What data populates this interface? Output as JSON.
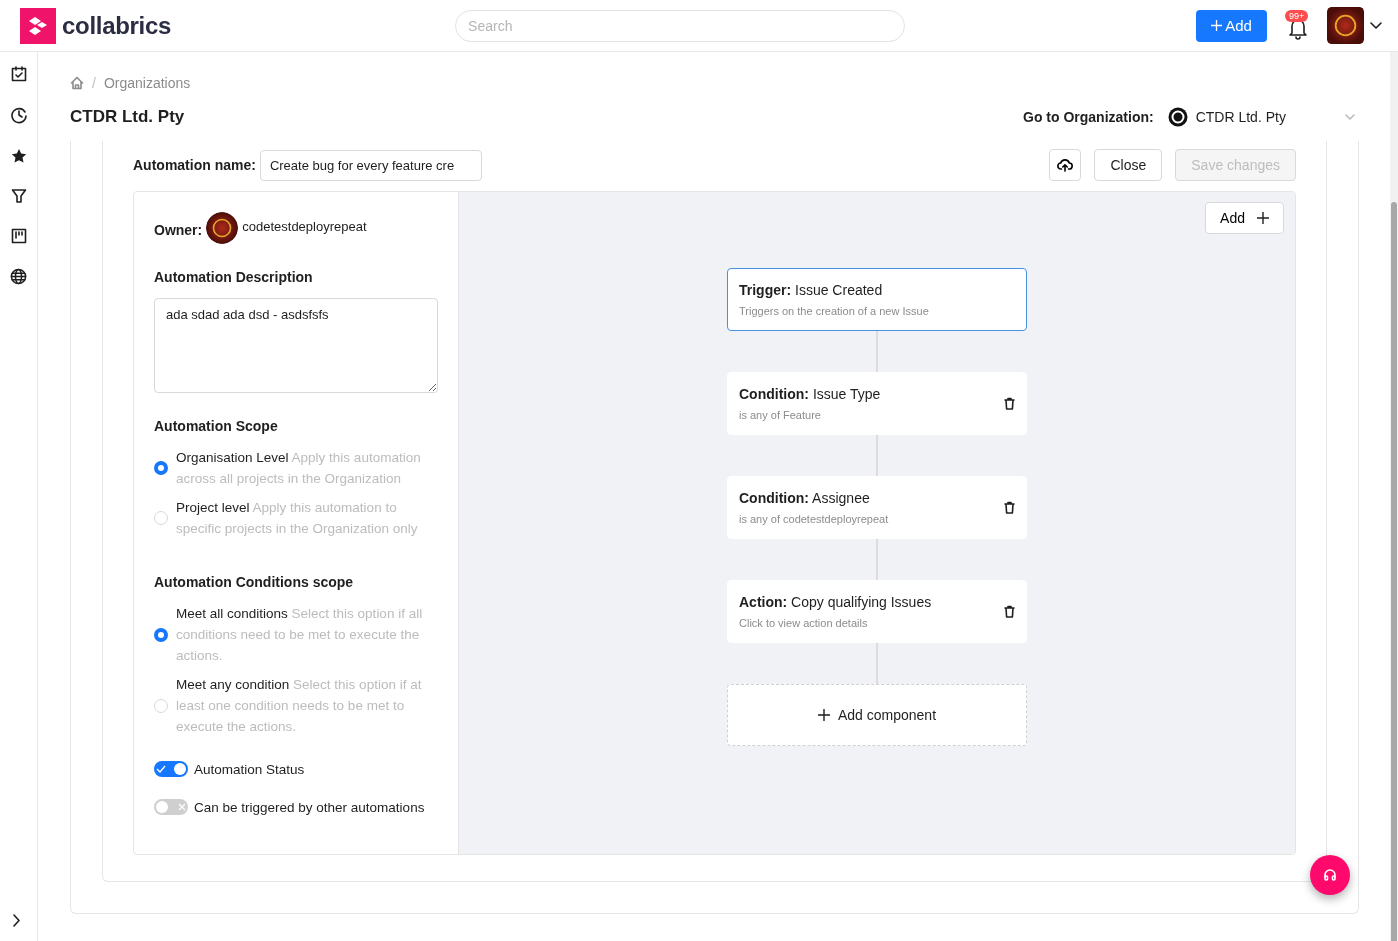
{
  "header": {
    "logo_text": "collabrics",
    "search": {
      "placeholder": "Search"
    },
    "add_button": "Add",
    "notification_badge": "99+"
  },
  "breadcrumb": {
    "separator": "/",
    "items": [
      "Organizations"
    ]
  },
  "page_title": "CTDR Ltd. Pty",
  "org_switch": {
    "label": "Go to Organization:",
    "value": "CTDR Ltd. Pty"
  },
  "automation": {
    "name_label": "Automation name:",
    "name_value": "Create bug for every feature cre",
    "buttons": [
      {
        "label": "Close",
        "disabled": false
      },
      {
        "label": "Save changes",
        "disabled": true
      }
    ],
    "owner_label": "Owner:",
    "owner_name": "codetestdeployrepeat",
    "description_heading": "Automation Description",
    "description": "ada sdad ada dsd - asdsfsfs",
    "scope_heading": "Automation Scope",
    "scope_options": [
      {
        "title": "Organisation Level",
        "description": "Apply this automation across all projects in the Organization",
        "selected": true
      },
      {
        "title": "Project level",
        "description": "Apply this automation to specific projects in the Organization only",
        "selected": false
      }
    ],
    "conditions_heading": "Automation Conditions scope",
    "condition_options": [
      {
        "title": "Meet all conditions",
        "description": "Select this option if all conditions need to be met to execute the actions.",
        "selected": true
      },
      {
        "title": "Meet any condition",
        "description": "Select this option if at least one condition needs to be met to execute the actions.",
        "selected": false
      }
    ],
    "toggles": [
      {
        "label": "Automation Status",
        "on": true
      },
      {
        "label": "Can be triggered by other automations",
        "on": false
      }
    ]
  },
  "canvas": {
    "add_button": "Add",
    "nodes": [
      {
        "kind": "trigger",
        "label": "Trigger:",
        "title": "Issue Created",
        "detail": "Triggers on the creation of a new Issue",
        "selected": true
      },
      {
        "kind": "condition",
        "label": "Condition:",
        "title": "Issue Type",
        "detail": "is any of Feature",
        "selected": false
      },
      {
        "kind": "condition",
        "label": "Condition:",
        "title": "Assignee",
        "detail": "is any of codetestdeployrepeat",
        "selected": false
      },
      {
        "kind": "action",
        "label": "Action:",
        "title": "Copy qualifying Issues",
        "detail": "Click to view action details",
        "selected": false
      }
    ],
    "add_component": "Add component"
  }
}
